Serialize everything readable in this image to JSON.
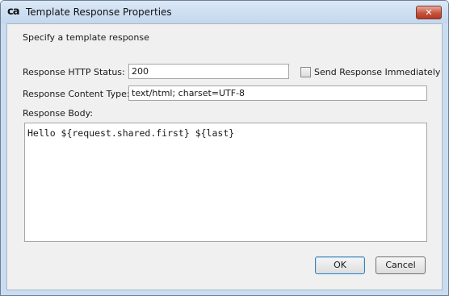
{
  "window": {
    "title": "Template Response Properties",
    "app_icon_text": "ca",
    "close_glyph": "✕"
  },
  "dialog": {
    "subtitle": "Specify a template response",
    "status_label": "Response HTTP Status:",
    "status_value": "200",
    "send_immediately_label": "Send Response Immediately",
    "send_immediately_checked": false,
    "content_type_label": "Response Content Type:",
    "content_type_value": "text/html; charset=UTF-8",
    "body_label": "Response Body:",
    "body_value": "Hello ${request.shared.first} ${last}"
  },
  "buttons": {
    "ok": "OK",
    "cancel": "Cancel"
  },
  "icons": {
    "close": "close-icon",
    "app": "ca-logo-icon"
  }
}
